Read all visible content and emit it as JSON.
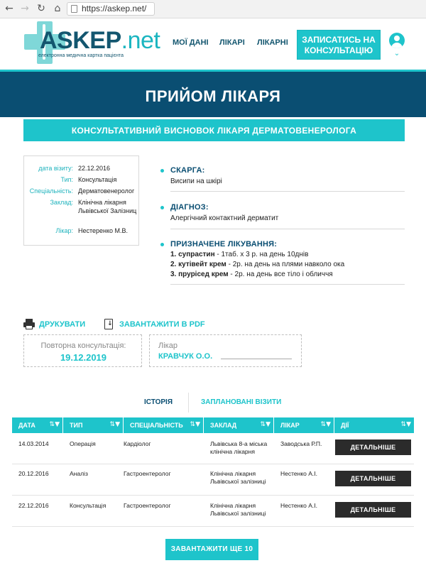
{
  "browser": {
    "back_icon": "←",
    "forward_icon": "→",
    "reload_icon": "↻",
    "home_icon": "⌂",
    "url": "https://askep.net/"
  },
  "header": {
    "logo_main": "ASKEP",
    "logo_tld": ".net",
    "logo_subtitle": "електронна медична картка пацієнта",
    "nav": [
      "МОЇ ДАНІ",
      "ЛІКАРІ",
      "ЛІКАРНІ"
    ],
    "cta": "ЗАПИСАТИСЬ НА КОНСУЛЬТАЦІЮ",
    "caret_icon": "⌄"
  },
  "page": {
    "title": "ПРИЙОМ ЛІКАРЯ",
    "subtitle": "КОНСУЛЬТАТИВНИЙ ВИСНОВОК ЛІКАРЯ ДЕРМАТОВЕНЕРОЛОГА"
  },
  "visit": {
    "rows": [
      {
        "label": "дата візиту:",
        "value": "22.12.2016"
      },
      {
        "label": "Тип:",
        "value": "Консультація"
      },
      {
        "label": "Спеціальність:",
        "value": "Дерматовенеролог"
      },
      {
        "label": "Заклад:",
        "value": "Клінічна лікарня Львівської Залізниц"
      },
      {
        "label": "Лікар:",
        "value": "Нестеренко М.В."
      }
    ]
  },
  "complaint": {
    "heading": "СКАРГА:",
    "text": "Висипи на шкірі"
  },
  "diagnosis": {
    "heading": "ДІАГНОЗ:",
    "text": "Алергічний контактний дерматит"
  },
  "treatment": {
    "heading": "ПРИЗНАЧЕНЕ ЛІКУВАННЯ:",
    "items": [
      {
        "num": "1.",
        "drug": "супрастин",
        "dose": " - 1таб. х 3 р. на день 10днів"
      },
      {
        "num": "2.",
        "drug": "кутівейт крем",
        "dose": " - 2р. на день на плями навколо ока"
      },
      {
        "num": "3.",
        "drug": "прурісед крем",
        "dose": " - 2р. на день все тіло і обличчя"
      }
    ]
  },
  "actions": {
    "print": "ДРУКУВАТИ",
    "pdf": "ЗАВАНТАЖИТИ В PDF"
  },
  "followup": {
    "label": "Повторна консультація:",
    "date": "19.12.2019"
  },
  "doctor": {
    "label": "Лікар",
    "name": "КРАВЧУК О.О."
  },
  "tabs": {
    "history": "ІСТОРІЯ",
    "planned": "ЗАПЛАНОВАНІ ВІЗИТИ"
  },
  "table": {
    "sort_icon": "⇅",
    "filter_icon": "▼",
    "columns": [
      "ДАТА",
      "ТИП",
      "СПЕЦІАЛЬНІСТЬ",
      "ЗАКЛАД",
      "ЛІКАР",
      "ДІЇ"
    ],
    "rows": [
      {
        "date": "14.03.2014",
        "type": "Операція",
        "specialty": "Кардіолог",
        "clinic": "Львівська 8-а міська клінічна лікарня",
        "doctor": "Заводська Р.П.",
        "action": "ДЕТАЛЬНІШЕ"
      },
      {
        "date": "20.12.2016",
        "type": "Аналіз",
        "specialty": "Гастроентеролог",
        "clinic": "Клінічна лікарня Львівської залізниці",
        "doctor": "Нестенко А.І.",
        "action": "ДЕТАЛЬНІШЕ"
      },
      {
        "date": "22.12.2016",
        "type": "Консультація",
        "specialty": "Гастроентеролог",
        "clinic": "Клінічна лікарня Львівської залізниці",
        "doctor": "Нестенко А.І.",
        "action": "ДЕТАЛЬНІШЕ"
      }
    ],
    "load_more": "ЗАВАНТАЖИТИ ЩЕ 10"
  }
}
